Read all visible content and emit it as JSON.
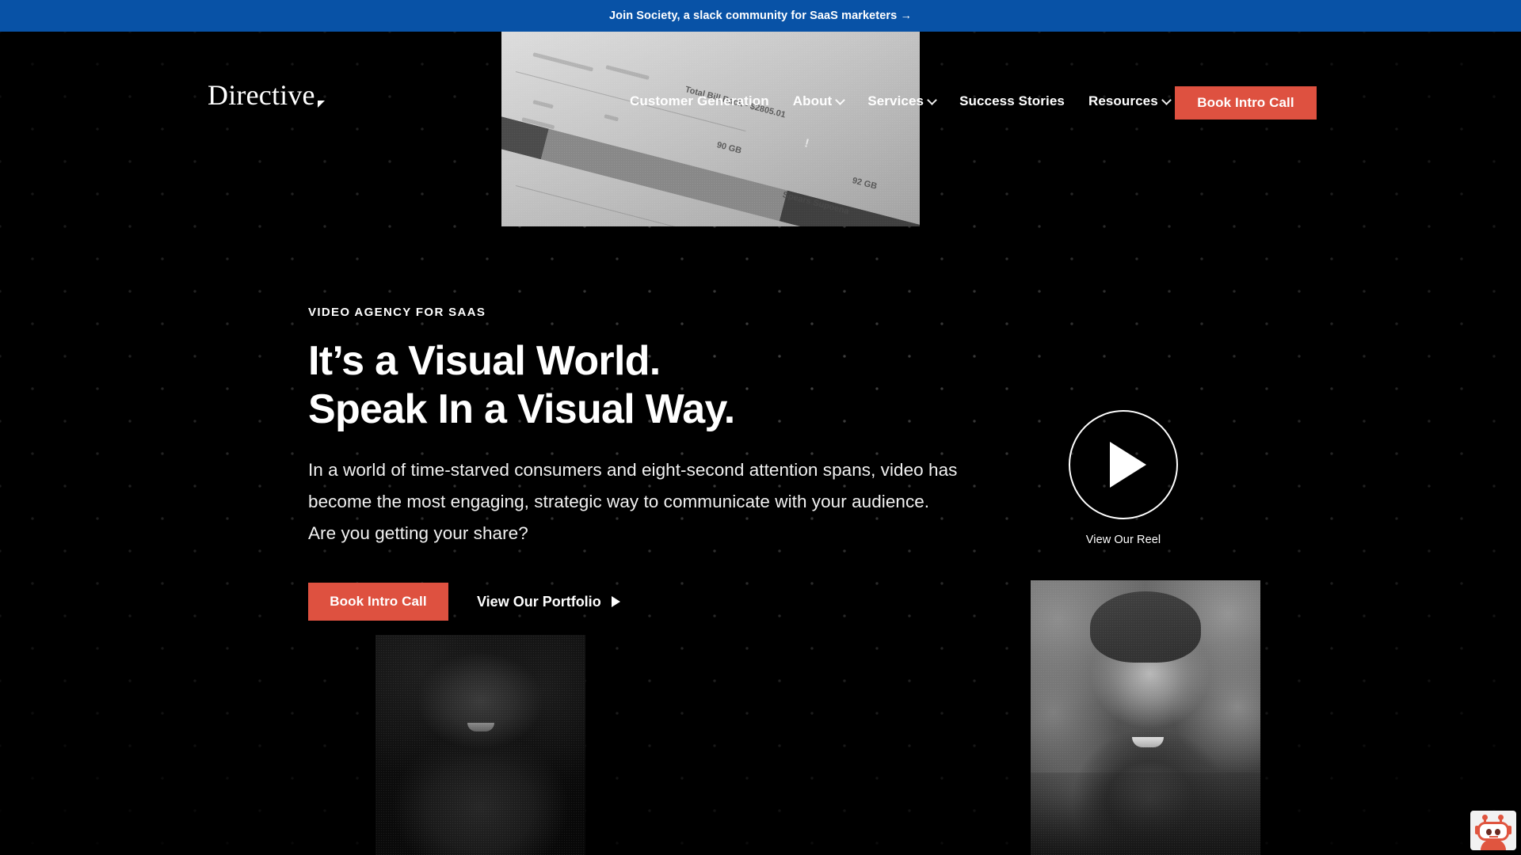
{
  "announcement": {
    "text": "Join Society, a slack community for SaaS marketers →",
    "bg_color": "#0852A6"
  },
  "brand": {
    "logo_text": "Directive",
    "accent_color": "#DE5140"
  },
  "nav": {
    "items": [
      {
        "label": "Customer Generation",
        "has_dropdown": false
      },
      {
        "label": "About",
        "has_dropdown": true
      },
      {
        "label": "Services",
        "has_dropdown": true
      },
      {
        "label": "Success Stories",
        "has_dropdown": false
      },
      {
        "label": "Resources",
        "has_dropdown": true
      }
    ],
    "cta_label": "Book Intro Call"
  },
  "hero": {
    "eyebrow": "VIDEO AGENCY FOR SAAS",
    "headline_line1": "It’s a Visual World.",
    "headline_line2": "Speak In a Visual Way.",
    "paragraph_line1": "In a world of time-starved consumers and eight-second attention spans, video has",
    "paragraph_line2": "become the most engaging, strategic way to communicate with your audience.",
    "paragraph_line3": "Are you getting your share?",
    "primary_cta": "Book Intro Call",
    "secondary_cta": "View Our Portfolio",
    "reel_label": "View Our Reel",
    "play_icon": "play-triangle-icon"
  },
  "media": {
    "top_thumbnail_alt": "photograph of a laptop screen showing a storage usage bar chart",
    "screen_labels": {
      "total": "Total Bill Back - $2805.01",
      "segment_mid": "90 GB",
      "segment_end": "92 GB",
      "footer": "Spears Supoena",
      "warning_glyph": "!"
    },
    "portrait_left_alt": "smiling man in a dark button-down shirt",
    "portrait_right_alt": "smiling man with shoulder-length hair and a pendant necklace"
  },
  "chat": {
    "icon": "robot-chat-icon",
    "label": "Chat"
  }
}
